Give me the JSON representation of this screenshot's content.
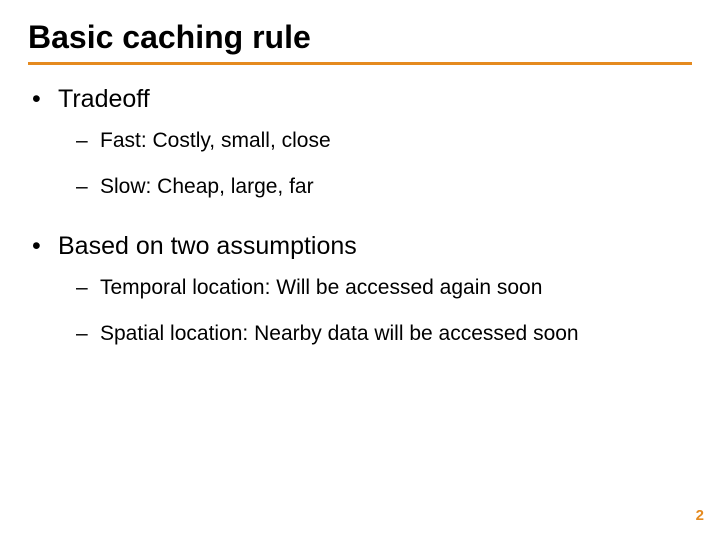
{
  "colors": {
    "accent": "#e58a1f"
  },
  "slide": {
    "title": "Basic caching rule",
    "page_number": "2",
    "items": [
      {
        "label": "Tradeoff",
        "sub": [
          {
            "text": "Fast:  Costly, small, close"
          },
          {
            "text": "Slow:  Cheap, large, far"
          }
        ]
      },
      {
        "label": "Based on two assumptions",
        "sub": [
          {
            "text": "Temporal location:  Will be accessed again soon"
          },
          {
            "text": "Spatial location:  Nearby data will be accessed soon"
          }
        ]
      }
    ]
  }
}
